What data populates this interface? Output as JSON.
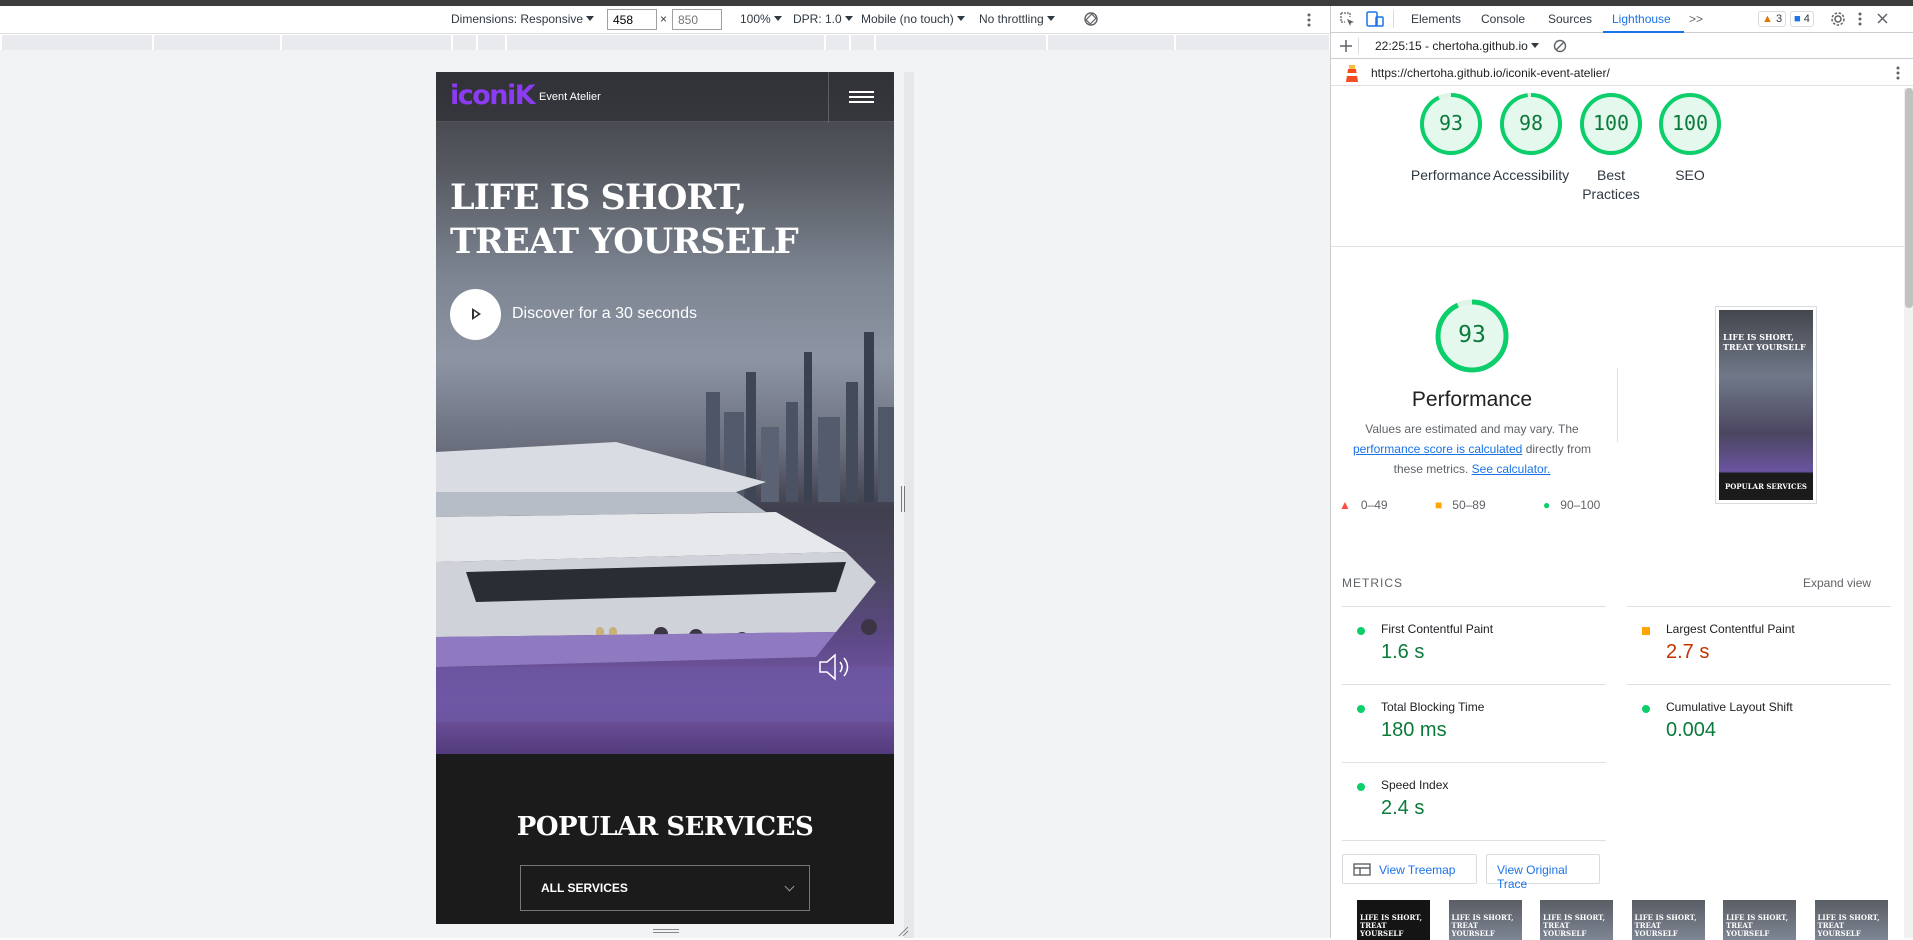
{
  "device_toolbar": {
    "dimensions_label": "Dimensions: Responsive",
    "width_value": "458",
    "height_placeholder": "850",
    "times": "×",
    "zoom": "100%",
    "dpr": "DPR: 1.0",
    "mode": "Mobile (no touch)",
    "throttling": "No throttling"
  },
  "site": {
    "logo": "iconiK",
    "logo_sub": "Event Atelier",
    "hero_title": "LIFE IS SHORT, TREAT YOURSELF",
    "discover": "Discover for a 30 seconds",
    "services_title": "POPULAR SERVICES",
    "services_select": "ALL SERVICES"
  },
  "devtools": {
    "tabs": [
      "Elements",
      "Console",
      "Sources",
      "Lighthouse"
    ],
    "more": ">>",
    "warnings": "3",
    "messages": "4",
    "report_time": "22:25:15 - chertoha.github.io",
    "url": "https://chertoha.github.io/iconik-event-atelier/"
  },
  "lighthouse": {
    "scores": [
      {
        "value": 93,
        "label": "Performance"
      },
      {
        "value": 98,
        "label": "Accessibility"
      },
      {
        "value": 100,
        "label": "Best Practices"
      },
      {
        "value": 100,
        "label": "SEO"
      }
    ],
    "performance": {
      "score": 93,
      "title": "Performance",
      "note_pre": "Values are estimated and may vary. The",
      "note_link1": "performance score is calculated",
      "note_mid": "directly from these metrics.",
      "note_link2": "See calculator."
    },
    "legend": {
      "fail": "0–49",
      "average": "50–89",
      "pass": "90–100"
    },
    "metrics_heading": "METRICS",
    "expand_view": "Expand view",
    "metrics": [
      {
        "name": "First Contentful Paint",
        "value": "1.6 s",
        "rating": "pass"
      },
      {
        "name": "Largest Contentful Paint",
        "value": "2.7 s",
        "rating": "average"
      },
      {
        "name": "Total Blocking Time",
        "value": "180 ms",
        "rating": "pass"
      },
      {
        "name": "Cumulative Layout Shift",
        "value": "0.004",
        "rating": "pass"
      },
      {
        "name": "Speed Index",
        "value": "2.4 s",
        "rating": "pass"
      }
    ],
    "view_treemap": "View Treemap",
    "view_trace": "View Original Trace",
    "thumb_title": "LIFE IS SHORT, TREAT YOURSELF",
    "thumb_services": "POPULAR SERVICES"
  },
  "colors": {
    "pass": "#0cce6b",
    "average": "#ffa400",
    "fail": "#ff4e42",
    "accent": "#1a73e8",
    "logo": "#8b3bf2"
  }
}
